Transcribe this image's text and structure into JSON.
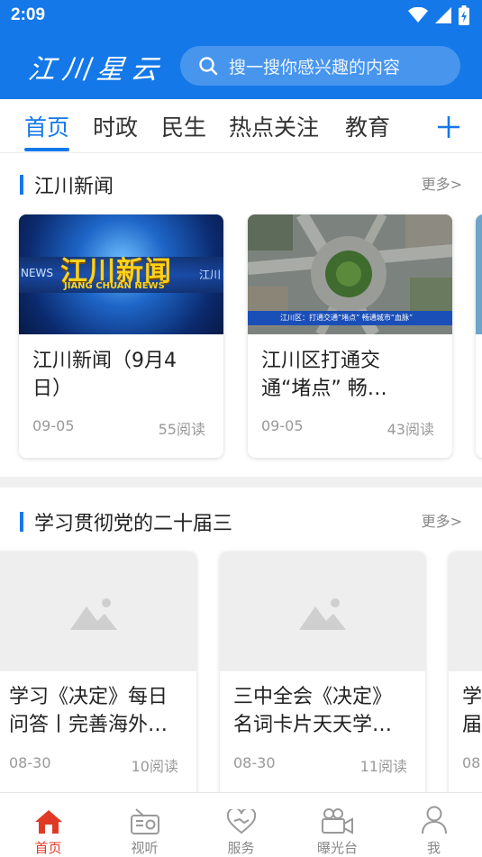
{
  "status_bar": {
    "time": "2:09"
  },
  "header": {
    "logo": "江川星云",
    "search_placeholder": "搜一搜你感兴趣的内容"
  },
  "tabs": [
    {
      "label": "首页",
      "active": true
    },
    {
      "label": "时政",
      "active": false
    },
    {
      "label": "民生",
      "active": false
    },
    {
      "label": "热点关注",
      "active": false
    },
    {
      "label": "教育",
      "active": false
    }
  ],
  "sections": [
    {
      "title": "江川新闻",
      "more": "更多>",
      "cards": [
        {
          "title_line1": "江川新闻（9月4",
          "title_line2": "日）",
          "date": "09-05",
          "reads": "55阅读",
          "thumb": {
            "main": "江川新闻",
            "sub": "JIANG CHUAN NEWS",
            "left": "NEWS",
            "right": "江川"
          }
        },
        {
          "title_line1": "江川区打通交",
          "title_line2": "通“堵点” 畅…",
          "date": "09-05",
          "reads": "43阅读",
          "thumb": {
            "caption": "江川区：打通交通“堵点” 畅通城市“血脉”"
          }
        }
      ]
    },
    {
      "title": "学习贯彻党的二十届三",
      "more": "更多>",
      "cards": [
        {
          "title_line1": "学习《决定》每日",
          "title_line2": "问答丨完善海外…",
          "date": "08-30",
          "reads": "10阅读"
        },
        {
          "title_line1": "三中全会《决定》",
          "title_line2": "名词卡片天天学…",
          "date": "08-30",
          "reads": "11阅读"
        },
        {
          "title_line1": "学",
          "title_line2": "届",
          "date": "08"
        }
      ]
    }
  ],
  "bottom_nav": [
    {
      "label": "首页",
      "icon": "home-icon",
      "active": true
    },
    {
      "label": "视听",
      "icon": "radio-icon",
      "active": false
    },
    {
      "label": "服务",
      "icon": "service-heart-icon",
      "active": false
    },
    {
      "label": "曝光台",
      "icon": "video-camera-icon",
      "active": false
    },
    {
      "label": "我",
      "icon": "user-icon",
      "active": false
    }
  ],
  "colors": {
    "brand": "#1478e8",
    "active_nav": "#e03a25"
  }
}
